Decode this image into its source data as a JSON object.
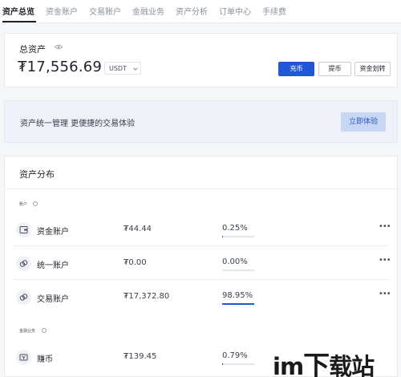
{
  "tabs": [
    {
      "label": "资产总览",
      "active": true
    },
    {
      "label": "资金账户",
      "active": false
    },
    {
      "label": "交易账户",
      "active": false
    },
    {
      "label": "金融业务",
      "active": false
    },
    {
      "label": "资产分析",
      "active": false
    },
    {
      "label": "订单中心",
      "active": false
    },
    {
      "label": "手续费",
      "active": false
    }
  ],
  "overview": {
    "label": "总资产",
    "value": "₮17,556.69",
    "currency": "USDT",
    "deposit_label": "充币",
    "withdraw_label": "提币",
    "transfer_label": "资金划转"
  },
  "banner": {
    "text": "资产统一管理 更便捷的交易体验",
    "button": "立即体验"
  },
  "distribution": {
    "title": "资产分布",
    "groups": [
      {
        "label": "账户",
        "rows": [
          {
            "name": "资金账户",
            "amount": "₮44.44",
            "pct": "0.25%",
            "fraction": 0.0025,
            "icon": "wallet-icon"
          },
          {
            "name": "统一账户",
            "amount": "₮0.00",
            "pct": "0.00%",
            "fraction": 0.0,
            "icon": "link-icon"
          },
          {
            "name": "交易账户",
            "amount": "₮17,372.80",
            "pct": "98.95%",
            "fraction": 0.9895,
            "icon": "link-icon"
          }
        ]
      },
      {
        "label": "金融业务",
        "rows": [
          {
            "name": "赚币",
            "amount": "₮139.45",
            "pct": "0.79%",
            "fraction": 0.0079,
            "icon": "earn-icon"
          }
        ]
      }
    ]
  },
  "watermark": {
    "a": "im",
    "b": "下",
    "c": "载站"
  },
  "colors": {
    "accent": "#1f57d8",
    "banner_bg": "#eef1f7",
    "track": "#e3e6eb"
  }
}
